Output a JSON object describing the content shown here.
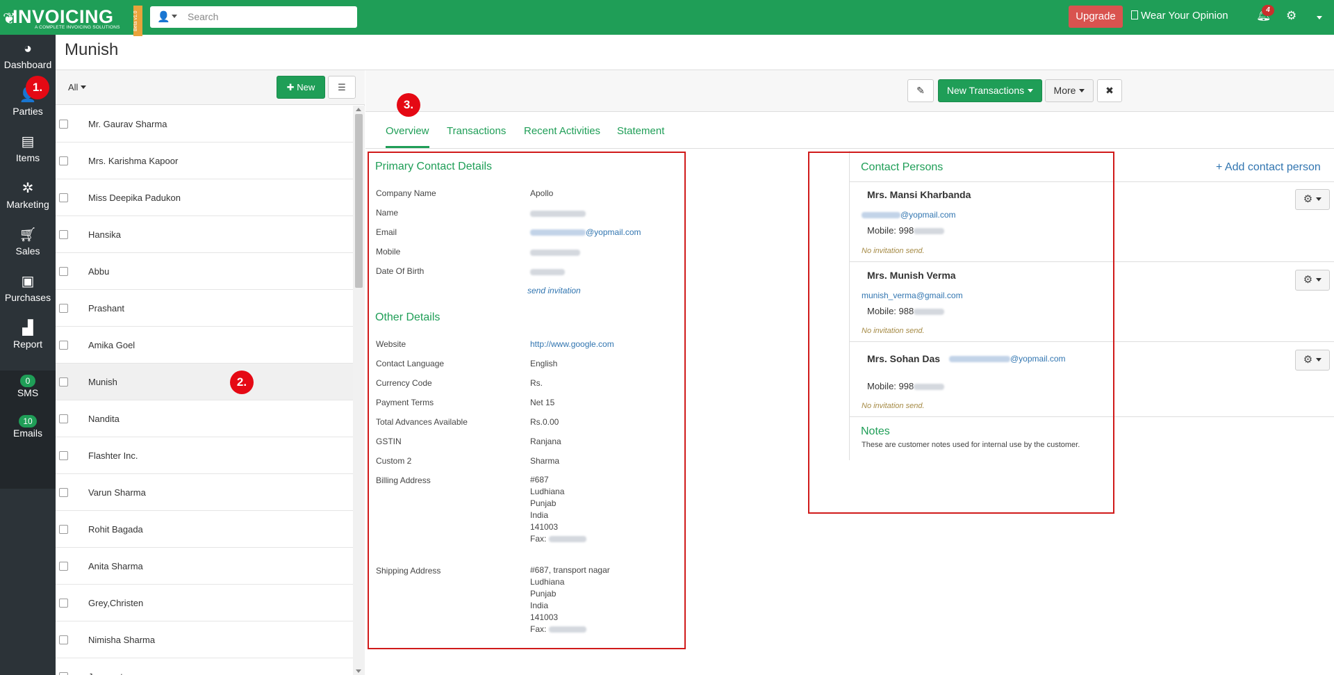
{
  "topbar": {
    "logo_text": "INVOICING",
    "logo_sub": "A COMPLETE INVOICING SOLUTIONS",
    "beta": "Beta v1.0",
    "search_placeholder": "Search",
    "upgrade_label": "Upgrade",
    "opinion_label": "Wear Your Opinion",
    "notification_count": "4"
  },
  "sidebar": {
    "items": [
      {
        "label": "Dashboard",
        "icon": "dashboard-icon"
      },
      {
        "label": "Parties",
        "icon": "user-icon"
      },
      {
        "label": "Items",
        "icon": "file-icon"
      },
      {
        "label": "Marketing",
        "icon": "share-icon"
      },
      {
        "label": "Sales",
        "icon": "cart-icon"
      },
      {
        "label": "Purchases",
        "icon": "bag-icon"
      },
      {
        "label": "Report",
        "icon": "chart-icon"
      }
    ],
    "sms_count": "0",
    "sms_label": "SMS",
    "emails_count": "10",
    "emails_label": "Emails"
  },
  "markers": [
    "1.",
    "2.",
    "3."
  ],
  "page_title": "Munish",
  "list": {
    "filter_label": "All",
    "new_label": "New",
    "parties": [
      "Mr. Gaurav Sharma",
      "Mrs. Karishma Kapoor",
      "Miss Deepika Padukon",
      "Hansika",
      "Abbu",
      "Prashant",
      "Amika Goel",
      "Munish",
      "Nandita",
      "Flashter Inc.",
      "Varun Sharma",
      "Rohit Bagada",
      "Anita Sharma",
      "Grey,Christen",
      "Nimisha Sharma",
      "Jaspreet"
    ],
    "active_index": 7
  },
  "detail_toolbar": {
    "new_transactions_label": "New Transactions",
    "more_label": "More"
  },
  "tabs": [
    "Overview",
    "Transactions",
    "Recent Activities",
    "Statement"
  ],
  "primary": {
    "title": "Primary Contact Details",
    "fields": [
      {
        "label": "Company Name",
        "value": "Apollo"
      },
      {
        "label": "Name",
        "value": ""
      },
      {
        "label": "Email",
        "value": "@yopmail.com"
      },
      {
        "label": "Mobile",
        "value": ""
      },
      {
        "label": "Date Of Birth",
        "value": ""
      }
    ],
    "send_invitation": "send invitation"
  },
  "other": {
    "title": "Other Details",
    "fields": [
      {
        "label": "Website",
        "value": "http://www.google.com"
      },
      {
        "label": "Contact Language",
        "value": "English"
      },
      {
        "label": "Currency Code",
        "value": "Rs."
      },
      {
        "label": "Payment Terms",
        "value": "Net 15"
      },
      {
        "label": "Total Advances Available",
        "value": "Rs.0.00"
      },
      {
        "label": "GSTIN",
        "value": "Ranjana"
      },
      {
        "label": "Custom 2",
        "value": "Sharma"
      }
    ],
    "billing_label": "Billing Address",
    "billing_lines": [
      "#687",
      "Ludhiana",
      "Punjab",
      "India",
      "141003",
      "Fax:"
    ],
    "shipping_label": "Shipping Address",
    "shipping_lines": [
      "#687, transport nagar",
      "Ludhiana",
      "Punjab",
      "India",
      "141003",
      "Fax:"
    ]
  },
  "contacts": {
    "title": "Contact Persons",
    "add_label": "+ Add contact person",
    "persons": [
      {
        "name": "Mrs. Mansi Kharbanda",
        "email": "@yopmail.com",
        "mobile_label": "Mobile:",
        "mobile": "998",
        "invitation": "No invitation send."
      },
      {
        "name": "Mrs. Munish Verma",
        "email": "munish_verma@gmail.com",
        "mobile_label": "Mobile:",
        "mobile": "988",
        "invitation": "No invitation send."
      },
      {
        "name": "Mrs. Sohan Das",
        "email": "@yopmail.com",
        "mobile_label": "Mobile:",
        "mobile": "998",
        "invitation": "No invitation send."
      }
    ],
    "notes_title": "Notes",
    "notes_text": "These are customer notes used for internal use by the customer."
  }
}
